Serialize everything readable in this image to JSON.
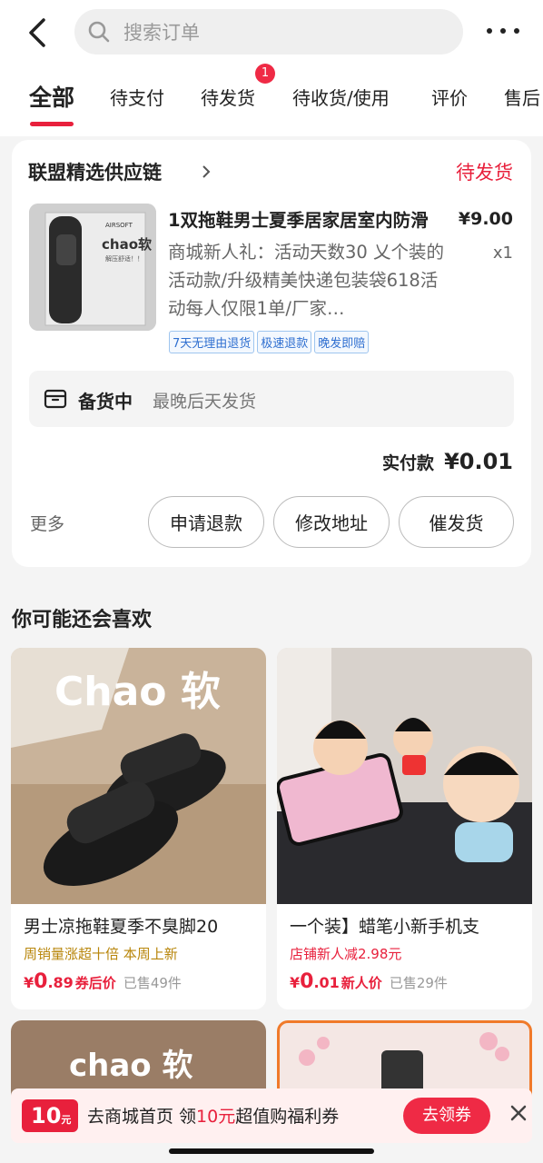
{
  "search": {
    "placeholder": "搜索订单"
  },
  "tabs": [
    {
      "label": "全部",
      "active": true
    },
    {
      "label": "待支付"
    },
    {
      "label": "待发货",
      "badge": "1"
    },
    {
      "label": "待收货/使用"
    },
    {
      "label": "评价"
    },
    {
      "label": "售后"
    }
  ],
  "order": {
    "shop_name": "联盟精选供应链",
    "status": "待发货",
    "product_name": "1双拖鞋男士夏季居家居室内防滑",
    "price": "¥9.00",
    "quantity": "x1",
    "description": "商城新人礼：活动天数30 乂个装的活动款/升级精美快递包装袋618活动每人仅限1单/厂家…",
    "tags": [
      "7天无理由退货",
      "极速退款",
      "晚发即赔"
    ],
    "prep_label": "备货中",
    "prep_note": "最晚后天发货",
    "paid_label": "实付款",
    "paid_value": "¥0.01",
    "more": "更多",
    "buttons": [
      "申请退款",
      "修改地址",
      "催发货"
    ],
    "thumb_text": {
      "brand": "AIRSOFT",
      "big": "chao软",
      "sub": "解压舒适！！"
    }
  },
  "recommend": {
    "title": "你可能还会喜欢",
    "items": [
      {
        "image_text": "Chao 软",
        "name": "男士凉拖鞋夏季不臭脚20",
        "sub": "周销量涨超十倍  本周上新",
        "price_int": "0",
        "price_dec": ".89",
        "price_label": "券后价",
        "sold": "已售49件"
      },
      {
        "image_text": "",
        "name": "一个装】蜡笔小新手机支",
        "sub": "店铺新人减2.98元",
        "price_int": "0",
        "price_dec": ".01",
        "price_label": "新人价",
        "sold": "已售29件"
      },
      {
        "image_text": "chao 软"
      },
      {
        "image_text": ""
      }
    ]
  },
  "banner": {
    "coupon_amount": "10",
    "coupon_unit": "元",
    "text_prefix": "去商城首页 领",
    "text_highlight": "10元",
    "text_suffix": "超值购福利券",
    "claim_button": "去领券"
  },
  "colors": {
    "accent": "#e8203c",
    "status": "#e8203c",
    "tag_blue": "#2f6fd0",
    "sub_gold": "#b8860b"
  }
}
